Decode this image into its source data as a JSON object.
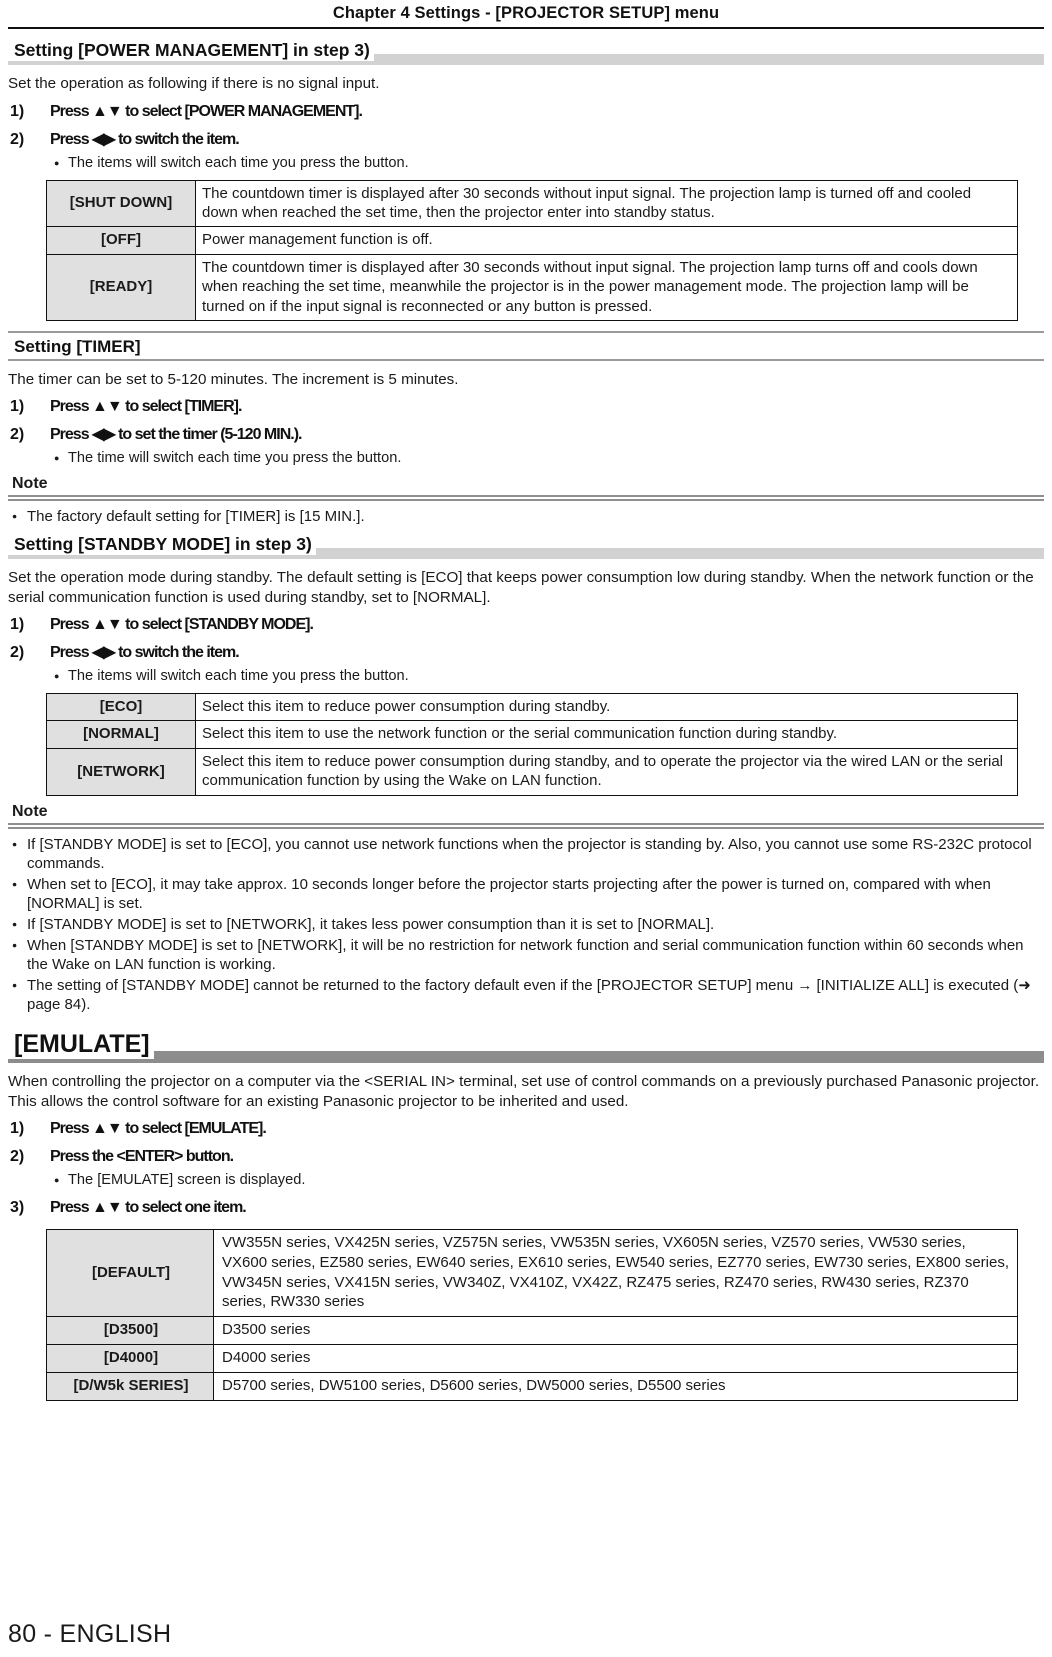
{
  "header": {
    "chapter": "Chapter 4   Settings - [PROJECTOR SETUP] menu"
  },
  "sections": {
    "power_management": {
      "heading": "Setting [POWER MANAGEMENT] in step 3)",
      "intro": "Set the operation as following if there is no signal input.",
      "steps": [
        {
          "num": "1)",
          "text": "Press ▲▼ to select [POWER MANAGEMENT]."
        },
        {
          "num": "2)",
          "text": "Press ◀▶ to switch the item."
        }
      ],
      "sub_bullet": "The items will switch each time you press the button.",
      "table": [
        {
          "key": "[SHUT DOWN]",
          "value": "The countdown timer is displayed after 30 seconds without input signal. The projection lamp is turned off and cooled down when reached the set time, then the projector enter into standby status."
        },
        {
          "key": "[OFF]",
          "value": "Power management function is off."
        },
        {
          "key": "[READY]",
          "value": "The countdown timer is displayed after 30 seconds without input signal. The projection lamp turns off and cools down when reaching the set time, meanwhile the projector is in the power management mode. The projection lamp will be turned on if the input signal is reconnected or any button is pressed."
        }
      ]
    },
    "timer": {
      "heading": "Setting [TIMER]",
      "intro": "The timer can be set to 5-120 minutes. The increment is 5 minutes.",
      "steps": [
        {
          "num": "1)",
          "text": "Press ▲▼ to select [TIMER]."
        },
        {
          "num": "2)",
          "text": "Press ◀▶ to set the timer (5-120 MIN.)."
        }
      ],
      "sub_bullet": "The time will switch each time you press the button.",
      "note_label": "Note",
      "notes": [
        "The factory default setting for [TIMER] is [15 MIN.]."
      ]
    },
    "standby_mode": {
      "heading": "Setting [STANDBY MODE] in step 3)",
      "intro": "Set the operation mode during standby. The default setting is [ECO] that keeps power consumption low during standby. When the network function or the serial communication function is used during standby, set to [NORMAL].",
      "steps": [
        {
          "num": "1)",
          "text": "Press ▲▼ to select [STANDBY MODE]."
        },
        {
          "num": "2)",
          "text": "Press ◀▶ to switch the item."
        }
      ],
      "sub_bullet": "The items will switch each time you press the button.",
      "table": [
        {
          "key": "[ECO]",
          "value": "Select this item to reduce power consumption during standby."
        },
        {
          "key": "[NORMAL]",
          "value": "Select this item to use the network function or the serial communication function during standby."
        },
        {
          "key": "[NETWORK]",
          "value": "Select this item to reduce power consumption during standby, and to operate the projector via the wired LAN or the serial communication function by using the Wake on LAN function."
        }
      ],
      "note_label": "Note",
      "notes": [
        "If [STANDBY MODE] is set to [ECO], you cannot use network functions when the projector is standing by. Also, you cannot use some RS-232C protocol commands.",
        "When set to [ECO], it may take approx. 10 seconds longer before the projector starts projecting after the power is turned on, compared with when [NORMAL] is set.",
        "If [STANDBY MODE] is set to [NETWORK], it takes less power consumption than it is set to [NORMAL].",
        "When [STANDBY MODE] is set to [NETWORK], it will be no restriction for network function and serial communication function within 60 seconds when the Wake on LAN function is working.",
        "The setting of [STANDBY MODE] cannot be returned to the factory default even if the [PROJECTOR SETUP] menu → [INITIALIZE ALL] is executed (➜ page 84)."
      ]
    },
    "emulate": {
      "heading": "[EMULATE]",
      "intro": "When controlling the projector on a computer via the <SERIAL IN> terminal, set use of control commands on a previously purchased Panasonic projector. This allows the control software for an existing Panasonic projector to be inherited and used.",
      "steps": [
        {
          "num": "1)",
          "text": "Press ▲▼ to select [EMULATE]."
        },
        {
          "num": "2)",
          "text": "Press the <ENTER> button."
        },
        {
          "num": "3)",
          "text": "Press ▲▼ to select one item."
        }
      ],
      "sub_bullet": "The [EMULATE] screen is displayed.",
      "table": [
        {
          "key": "[DEFAULT]",
          "value": "VW355N series, VX425N series, VZ575N series, VW535N series, VX605N series, VZ570 series, VW530 series, VX600 series, EZ580 series, EW640 series, EX610 series, EW540 series, EZ770 series, EW730 series, EX800 series, VW345N series, VX415N series, VW340Z, VX410Z, VX42Z, RZ475 series, RZ470 series, RW430 series, RZ370 series, RW330 series"
        },
        {
          "key": "[D3500]",
          "value": "D3500 series"
        },
        {
          "key": "[D4000]",
          "value": "D4000 series"
        },
        {
          "key": "[D/W5k SERIES]",
          "value": "D5700 series, DW5100 series, D5600 series, DW5000 series, D5500 series"
        }
      ]
    }
  },
  "footer": {
    "page_label": "80 - ENGLISH"
  },
  "colors": {
    "heading_band_light": "#d2d2d2",
    "heading_band_dark": "#8d8d8d",
    "table_key_bg": "#e0e0e0",
    "rule": "#8f8f8f",
    "text": "#1a1a1a"
  }
}
